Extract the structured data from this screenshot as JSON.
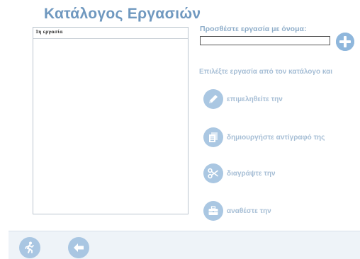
{
  "page": {
    "title": "Κατάλογος Εργασιών"
  },
  "task_list": {
    "items": [
      "1η εργασία"
    ]
  },
  "add_task": {
    "label": "Προσθέστε εργασία με όνομα:",
    "input_value": "",
    "add_icon": "plus-icon"
  },
  "select_task": {
    "label": "Επιλέξτε εργασία από τον κατάλογο και"
  },
  "actions": {
    "edit": {
      "label": "επιμεληθείτε την",
      "icon": "pencil-icon"
    },
    "copy": {
      "label": "δημιουργήστε αντίγραφό της",
      "icon": "document-copy-icon"
    },
    "delete": {
      "label": "διαγράψτε την",
      "icon": "scissors-icon"
    },
    "assign": {
      "label": "αναθέστε την",
      "icon": "briefcase-icon"
    }
  },
  "bottom_bar": {
    "exit_icon": "running-person-icon",
    "back_icon": "arrow-left-icon"
  },
  "colors": {
    "title": "#6f98bf",
    "accent": "#8fb7dc",
    "action_circle": "#aac7e2",
    "label_muted": "#a6bed5"
  }
}
